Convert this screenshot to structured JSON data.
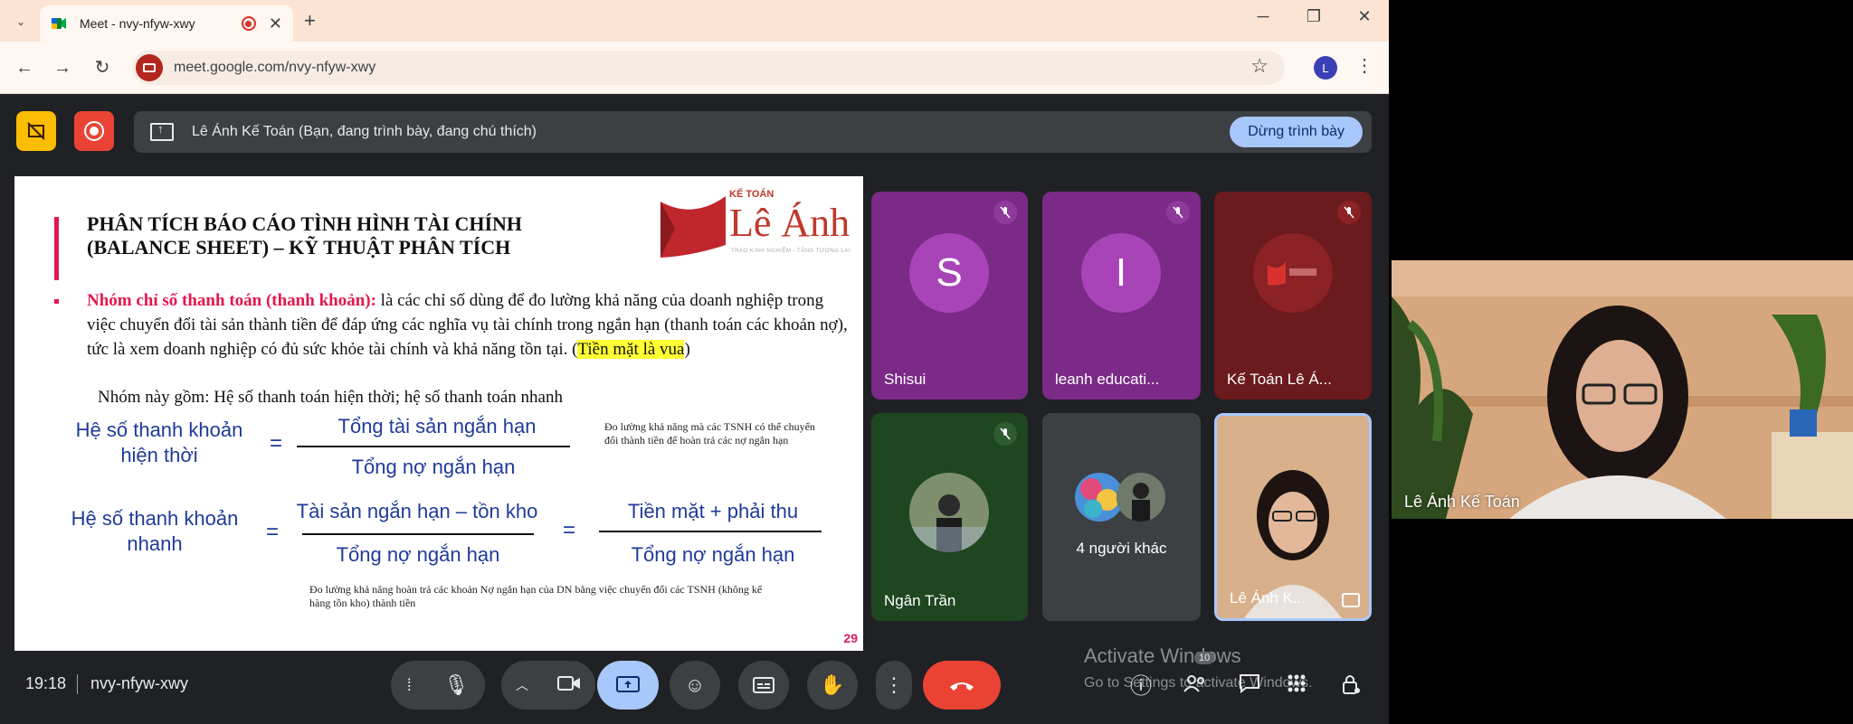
{
  "browser": {
    "tab_title": "Meet - nvy-nfyw-xwy",
    "url": "meet.google.com/nvy-nfyw-xwy",
    "profile_initial": "L"
  },
  "meet": {
    "presenting_text": "Lê Ánh Kế Toán (Bạn, đang trình bày, đang chú thích)",
    "stop_presenting": "Dừng trình bày",
    "time": "19:18",
    "meeting_code": "nvy-nfyw-xwy",
    "participant_count": "10",
    "watermark_line1": "Activate Windows",
    "watermark_line2": "Go to Settings to activate Windows."
  },
  "slide": {
    "title_line1": "PHÂN TÍCH BÁO CÁO TÌNH HÌNH TÀI CHÍNH",
    "title_line2": "(BALANCE SHEET) – KỸ THUẬT PHÂN TÍCH",
    "logo_small": "KẾ TOÁN",
    "logo_big": "Lê Ánh",
    "logo_tagline": "TRAO KINH NGHIỆM - TĂNG TƯƠNG LAI",
    "bullet_bold": "Nhóm chỉ số thanh toán (thanh khoản):",
    "bullet_text": " là các chỉ số dùng để đo lường khả năng của doanh nghiệp trong việc chuyển đổi tài sản thành tiền để đáp ứng các nghĩa vụ tài chính trong ngắn hạn (thanh toán các khoản nợ), tức là xem doanh nghiệp có đủ sức khỏe tài chính và khả năng tồn tại. (",
    "bullet_highlight": "Tiền mặt là vua",
    "bullet_end": ")",
    "group_line": "Nhóm này gồm: Hệ số thanh toán hiện thời; hệ số thanh toán nhanh",
    "f1_label_line1": "Hệ số thanh khoản",
    "f1_label_line2": "hiện thời",
    "f1_numerator": "Tổng tài sản ngắn hạn",
    "f1_denominator": "Tổng nợ ngắn hạn",
    "f1_note": "Đo lường khả năng mà các TSNH có thể chuyển đổi thành tiền để hoàn trả các nợ ngắn hạn",
    "f2_label_line1": "Hệ số thanh khoản",
    "f2_label_line2": "nhanh",
    "f2_numerator": "Tài sản ngắn hạn – tồn kho",
    "f2_denominator": "Tổng nợ ngắn hạn",
    "f2b_numerator": "Tiền mặt + phải thu",
    "f2b_denominator": "Tổng nợ ngắn hạn",
    "f2_note": "Đo lường khả năng hoàn trả các khoản Nợ ngắn hạn của DN bằng việc chuyển đổi các TSNH (không kể hàng tồn kho) thành tiền",
    "equals": "=",
    "page_number": "29"
  },
  "participants": [
    {
      "name": "Shisui",
      "initial": "S",
      "muted": true
    },
    {
      "name": "leanh educati...",
      "initial": "I",
      "muted": true
    },
    {
      "name": "Kế Toán Lê Á...",
      "muted": true
    },
    {
      "name": "Ngân Trần",
      "muted": true
    },
    {
      "name": "4 người khác"
    },
    {
      "name": "Lê Ánh K..."
    }
  ],
  "selfview": {
    "name": "Lê Ánh Kế Toán"
  },
  "colors": {
    "meet_bg": "#202124",
    "tile_purple": "#7b2a87",
    "tile_maroon": "#6b1a1d",
    "tile_gray": "#3c4043",
    "end_call": "#ea4335",
    "stop_btn": "#a8c7fa"
  }
}
